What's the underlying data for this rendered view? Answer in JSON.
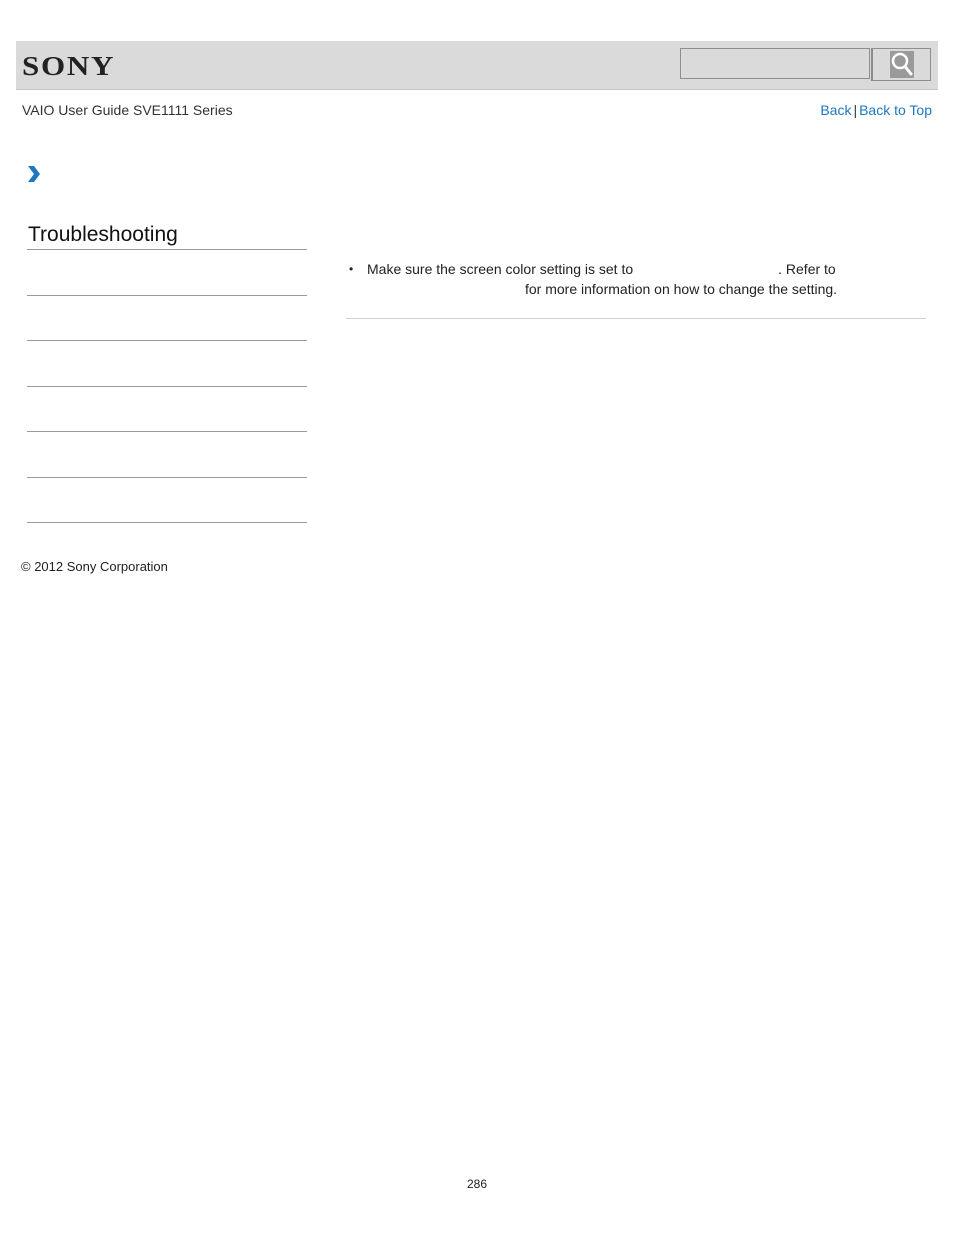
{
  "header": {
    "logo": "SONY",
    "search": {
      "value": "",
      "placeholder": ""
    },
    "search_icon": "search-icon"
  },
  "subheader": {
    "guide_title": "VAIO User Guide SVE1111 Series",
    "links": {
      "back": "Back",
      "separator": "|",
      "back_to_top": "Back to Top"
    }
  },
  "breadcrumb": {
    "icon": "chevron-right-icon",
    "accent_color": "#1f77c0"
  },
  "sidebar": {
    "title": "Troubleshooting",
    "items": [
      "",
      "",
      "",
      "",
      "",
      ""
    ]
  },
  "content": {
    "bullet": "•",
    "line1_prefix": "Make sure the screen color setting is set to",
    "line1_suffix": ". Refer to",
    "line2": "for more information on how to change the setting."
  },
  "footer": {
    "copyright": "© 2012 Sony Corporation",
    "page_number": "286"
  }
}
